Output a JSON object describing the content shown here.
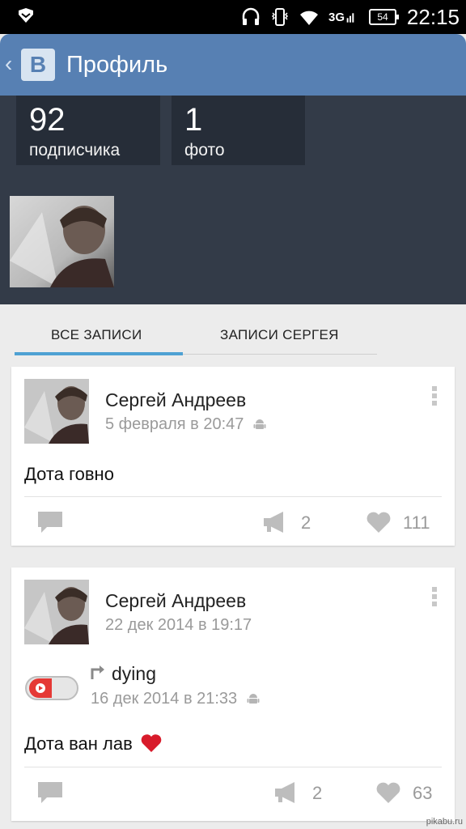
{
  "status_bar": {
    "time": "22:15",
    "network": "3G",
    "battery": "54",
    "icons": [
      "shield-icon",
      "headphones-icon",
      "vibrate-icon",
      "wifi-icon",
      "signal-icon",
      "battery-icon"
    ]
  },
  "header": {
    "logo": "В",
    "title": "Профиль",
    "back_icon": "chevron-left-icon",
    "color": "#5780b3"
  },
  "profile": {
    "stats": [
      {
        "value": "92",
        "label": "подписчика"
      },
      {
        "value": "1",
        "label": "фото"
      }
    ]
  },
  "tabs": [
    {
      "label": "ВСЕ ЗАПИСИ",
      "active": true
    },
    {
      "label": "ЗАПИСИ СЕРГЕЯ",
      "active": false
    }
  ],
  "accent_color": "#4ea1d3",
  "posts": [
    {
      "author": "Сергей Андреев",
      "date": "5 февраля в 20:47",
      "text": "Дота говно",
      "reposts": "2",
      "likes": "111"
    },
    {
      "author": "Сергей Андреев",
      "date": "22 дек 2014 в 19:17",
      "repost": {
        "name": "dying",
        "date": "16 дек 2014 в 21:33"
      },
      "text": "Дота ван лав",
      "reposts": "2",
      "likes": "63"
    }
  ],
  "watermark": "pikabu.ru"
}
